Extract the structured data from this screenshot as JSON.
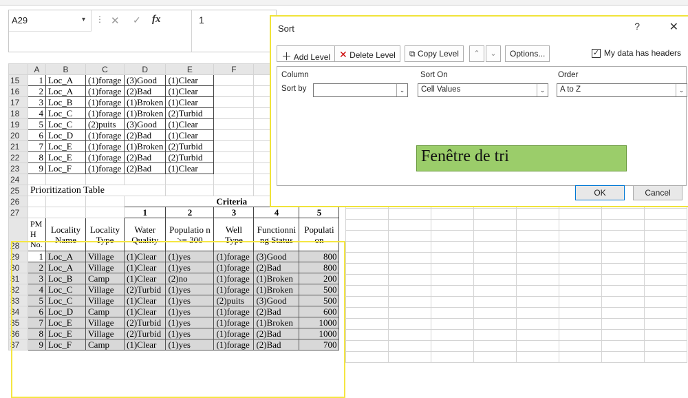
{
  "formula_bar": {
    "name_box": "A29",
    "dropdown": "▾",
    "sep": "⋮",
    "cancel": "✕",
    "enter": "✓",
    "fx": "fx",
    "value": "1"
  },
  "columns": [
    "A",
    "B",
    "C",
    "D",
    "E",
    "F"
  ],
  "top_rows": [
    {
      "row": "15",
      "a": "1",
      "b": "Loc_A",
      "c": "(1)forage",
      "d": "(3)Good",
      "e": "(1)Clear"
    },
    {
      "row": "16",
      "a": "2",
      "b": "Loc_A",
      "c": "(1)forage",
      "d": "(2)Bad",
      "e": "(1)Clear"
    },
    {
      "row": "17",
      "a": "3",
      "b": "Loc_B",
      "c": "(1)forage",
      "d": "(1)Broken",
      "e": "(1)Clear"
    },
    {
      "row": "18",
      "a": "4",
      "b": "Loc_C",
      "c": "(1)forage",
      "d": "(1)Broken",
      "e": "(2)Turbid"
    },
    {
      "row": "19",
      "a": "5",
      "b": "Loc_C",
      "c": "(2)puits",
      "d": "(3)Good",
      "e": "(1)Clear"
    },
    {
      "row": "20",
      "a": "6",
      "b": "Loc_D",
      "c": "(1)forage",
      "d": "(2)Bad",
      "e": "(1)Clear"
    },
    {
      "row": "21",
      "a": "7",
      "b": "Loc_E",
      "c": "(1)forage",
      "d": "(1)Broken",
      "e": "(2)Turbid"
    },
    {
      "row": "22",
      "a": "8",
      "b": "Loc_E",
      "c": "(1)forage",
      "d": "(2)Bad",
      "e": "(2)Turbid"
    },
    {
      "row": "23",
      "a": "9",
      "b": "Loc_F",
      "c": "(1)forage",
      "d": "(2)Bad",
      "e": "(1)Clear"
    }
  ],
  "row24": "24",
  "row25": {
    "row": "25",
    "text": "Prioritization Table"
  },
  "row26": {
    "row": "26",
    "text": "Criteria"
  },
  "row27": {
    "row": "27",
    "nums": [
      "1",
      "2",
      "3",
      "4",
      "5"
    ]
  },
  "row28": {
    "row": "28",
    "headers": [
      "PM H No.",
      "Locality Name",
      "Locality Type",
      "Water Quality",
      "Populatio n >= 300",
      "Well Type",
      "Functionni ng Status",
      "Populati on"
    ]
  },
  "data_rows": [
    {
      "row": "29",
      "no": "1",
      "name": "Loc_A",
      "type": "Village",
      "water": "(1)Clear",
      "pop300": "(1)yes",
      "well": "(1)forage",
      "status": "(3)Good",
      "pop": "800"
    },
    {
      "row": "30",
      "no": "2",
      "name": "Loc_A",
      "type": "Village",
      "water": "(1)Clear",
      "pop300": "(1)yes",
      "well": "(1)forage",
      "status": "(2)Bad",
      "pop": "800"
    },
    {
      "row": "31",
      "no": "3",
      "name": "Loc_B",
      "type": "Camp",
      "water": "(1)Clear",
      "pop300": "(2)no",
      "well": "(1)forage",
      "status": "(1)Broken",
      "pop": "200"
    },
    {
      "row": "32",
      "no": "4",
      "name": "Loc_C",
      "type": "Village",
      "water": "(2)Turbid",
      "pop300": "(1)yes",
      "well": "(1)forage",
      "status": "(1)Broken",
      "pop": "500"
    },
    {
      "row": "33",
      "no": "5",
      "name": "Loc_C",
      "type": "Village",
      "water": "(1)Clear",
      "pop300": "(1)yes",
      "well": "(2)puits",
      "status": "(3)Good",
      "pop": "500"
    },
    {
      "row": "34",
      "no": "6",
      "name": "Loc_D",
      "type": "Camp",
      "water": "(1)Clear",
      "pop300": "(1)yes",
      "well": "(1)forage",
      "status": "(2)Bad",
      "pop": "600"
    },
    {
      "row": "35",
      "no": "7",
      "name": "Loc_E",
      "type": "Village",
      "water": "(2)Turbid",
      "pop300": "(1)yes",
      "well": "(1)forage",
      "status": "(1)Broken",
      "pop": "1000"
    },
    {
      "row": "36",
      "no": "8",
      "name": "Loc_E",
      "type": "Village",
      "water": "(2)Turbid",
      "pop300": "(1)yes",
      "well": "(1)forage",
      "status": "(2)Bad",
      "pop": "1000"
    },
    {
      "row": "37",
      "no": "9",
      "name": "Loc_F",
      "type": "Camp",
      "water": "(1)Clear",
      "pop300": "(1)yes",
      "well": "(1)forage",
      "status": "(2)Bad",
      "pop": "700"
    }
  ],
  "dialog": {
    "title": "Sort",
    "help": "?",
    "close": "✕",
    "add_level": "Add Level",
    "delete_level": "Delete Level",
    "copy_level": "Copy Level",
    "up": "⌃",
    "down": "⌄",
    "options": "Options...",
    "my_headers": "My data has headers",
    "headers_checked": true,
    "col_column": "Column",
    "col_sort_on": "Sort On",
    "col_order": "Order",
    "sort_by": "Sort by",
    "column_value": "",
    "sort_on_value": "Cell Values",
    "order_value": "A to Z",
    "annotation": "Fenêtre de tri",
    "ok": "OK",
    "cancel": "Cancel"
  },
  "colors": {
    "highlight": "#f5e642",
    "annotation_bg": "#9bcd6a",
    "selected_cell": "#d8d8d8"
  }
}
